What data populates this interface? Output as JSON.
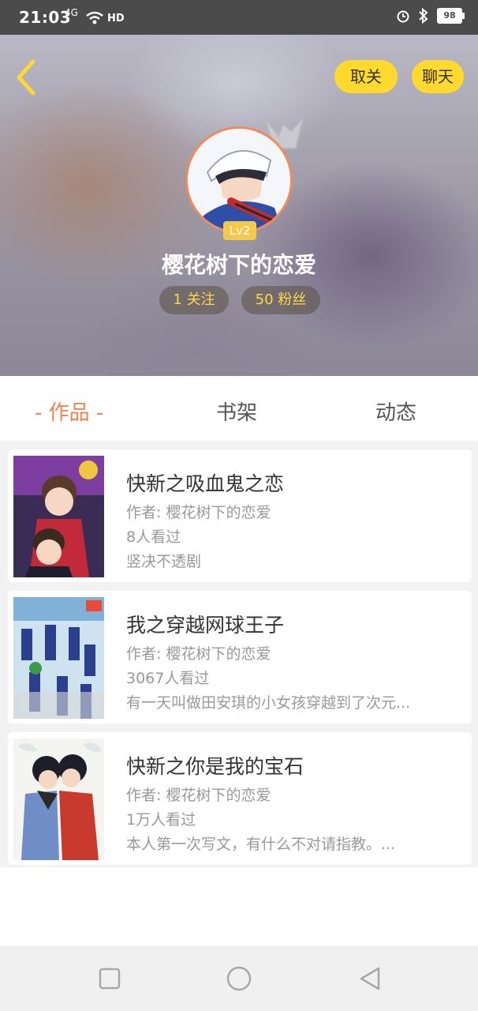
{
  "status_bar": {
    "time": "21:03",
    "network": "4G",
    "hd": "HD",
    "battery": "98",
    "icons": [
      "signal-icon",
      "wifi-icon",
      "alarm-icon",
      "bluetooth-icon",
      "battery-icon"
    ]
  },
  "header": {
    "back_icon": "chevron-left-icon",
    "unfollow_label": "取关",
    "chat_label": "聊天",
    "level": "Lv2",
    "username": "樱花树下的恋爱",
    "following": "1 关注",
    "fans": "50 粉丝"
  },
  "tabs": [
    {
      "label": "- 作品 -",
      "active": true
    },
    {
      "label": "书架",
      "active": false
    },
    {
      "label": "动态",
      "active": false
    }
  ],
  "works": [
    {
      "title": "快新之吸血鬼之恋",
      "author": "作者: 樱花树下的恋爱",
      "views": "8人看过",
      "desc": "竖决不透剧"
    },
    {
      "title": "我之穿越网球王子",
      "author": "作者: 樱花树下的恋爱",
      "views": "3067人看过",
      "desc": "有一天叫做田安琪的小女孩穿越到了次元..."
    },
    {
      "title": "快新之你是我的宝石",
      "author": "作者: 樱花树下的恋爱",
      "views": "1万人看过",
      "desc": "本人第一次写文，有什么不对请指教。..."
    }
  ],
  "colors": {
    "accent": "#f0834d",
    "button_yellow": "#ffd92e",
    "stat_text": "#ffd84a"
  }
}
